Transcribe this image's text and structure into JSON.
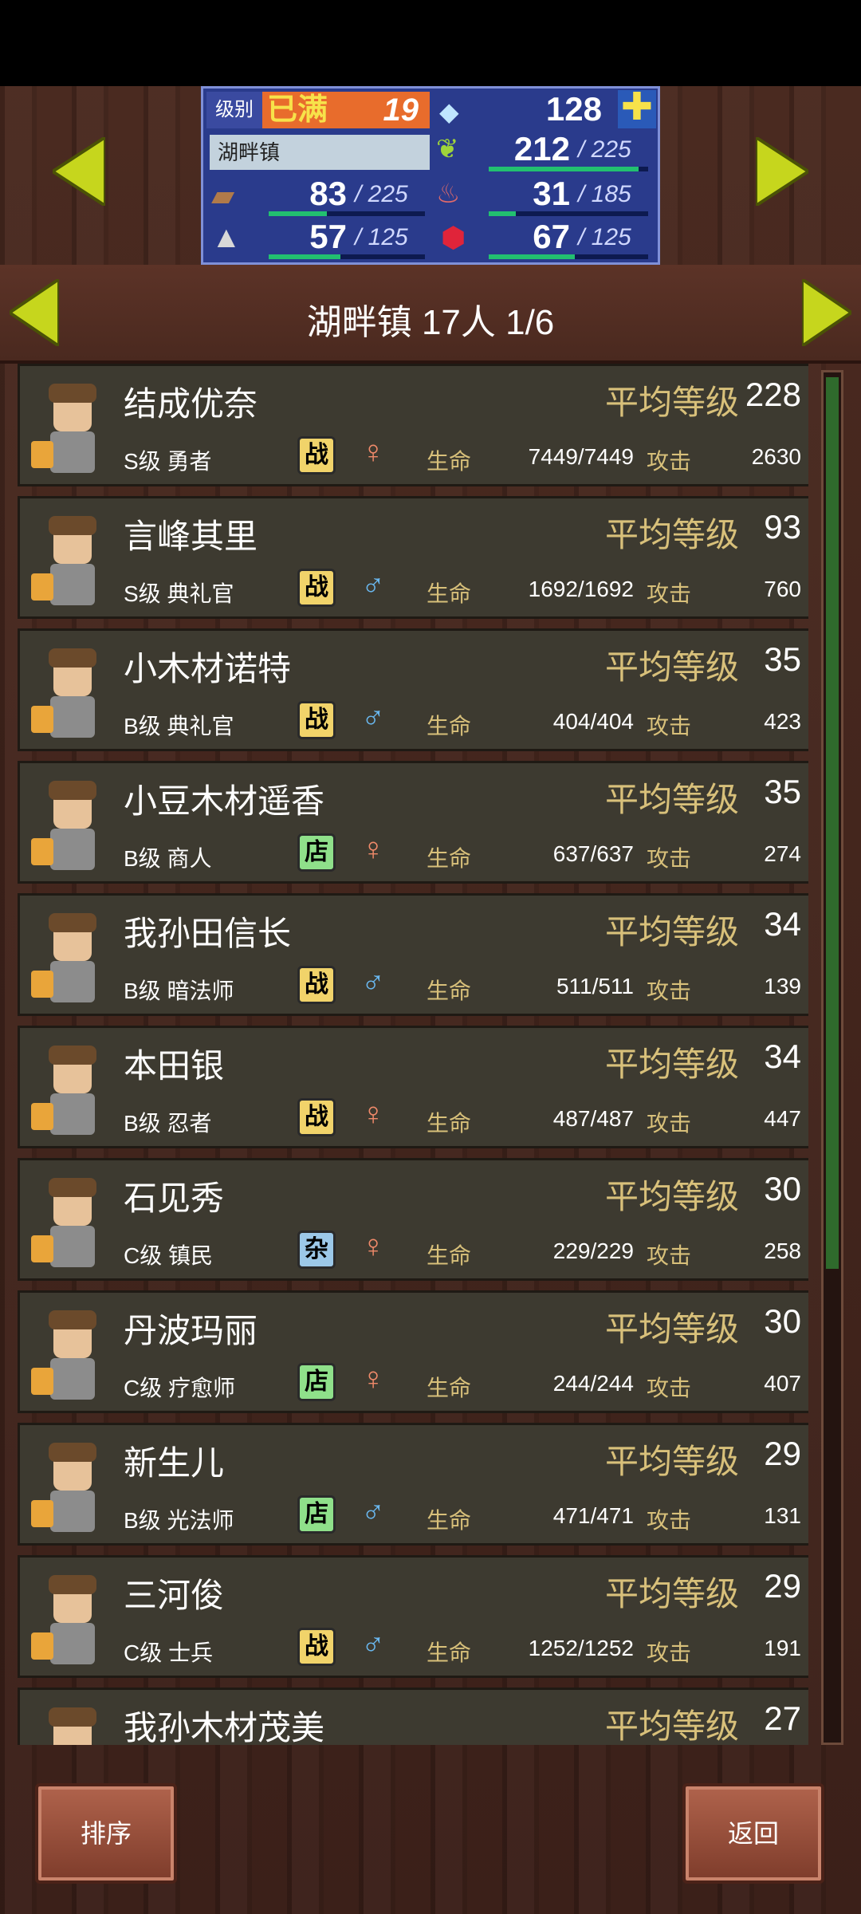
{
  "header": {
    "level_label": "级别",
    "level_status": "已满",
    "level_value": "19",
    "gems": "128",
    "town_name": "湖畔镇",
    "food": {
      "value": "212",
      "max": "225",
      "fill": 0.94
    },
    "wood": {
      "value": "83",
      "max": "225",
      "fill": 0.37
    },
    "meat": {
      "value": "31",
      "max": "185",
      "fill": 0.17
    },
    "ore": {
      "value": "57",
      "max": "125",
      "fill": 0.46
    },
    "ruby": {
      "value": "67",
      "max": "125",
      "fill": 0.54
    }
  },
  "town_bar": {
    "title": "湖畔镇  17人 1/6"
  },
  "labels": {
    "avg_level": "平均等级",
    "hp": "生命",
    "atk": "攻击"
  },
  "residents": [
    {
      "name": "结成优奈",
      "avg": "228",
      "class": "S级 勇者",
      "type": "战",
      "gender": "♀",
      "hp": "7449/7449",
      "atk": "2630"
    },
    {
      "name": "言峰其里",
      "avg": "93",
      "class": "S级 典礼官",
      "type": "战",
      "gender": "♂",
      "hp": "1692/1692",
      "atk": "760"
    },
    {
      "name": "小木材诺特",
      "avg": "35",
      "class": "B级 典礼官",
      "type": "战",
      "gender": "♂",
      "hp": "404/404",
      "atk": "423"
    },
    {
      "name": "小豆木材遥香",
      "avg": "35",
      "class": "B级 商人",
      "type": "店",
      "gender": "♀",
      "hp": "637/637",
      "atk": "274"
    },
    {
      "name": "我孙田信长",
      "avg": "34",
      "class": "B级 暗法师",
      "type": "战",
      "gender": "♂",
      "hp": "511/511",
      "atk": "139"
    },
    {
      "name": "本田银",
      "avg": "34",
      "class": "B级 忍者",
      "type": "战",
      "gender": "♀",
      "hp": "487/487",
      "atk": "447"
    },
    {
      "name": "石见秀",
      "avg": "30",
      "class": "C级 镇民",
      "type": "杂",
      "gender": "♀",
      "hp": "229/229",
      "atk": "258"
    },
    {
      "name": "丹波玛丽",
      "avg": "30",
      "class": "C级 疗愈师",
      "type": "店",
      "gender": "♀",
      "hp": "244/244",
      "atk": "407"
    },
    {
      "name": "新生儿",
      "avg": "29",
      "class": "B级 光法师",
      "type": "店",
      "gender": "♂",
      "hp": "471/471",
      "atk": "131"
    },
    {
      "name": "三河俊",
      "avg": "29",
      "class": "C级 士兵",
      "type": "战",
      "gender": "♂",
      "hp": "1252/1252",
      "atk": "191"
    },
    {
      "name": "我孙木材茂美",
      "avg": "27",
      "class": "",
      "type": "",
      "gender": "",
      "hp": "",
      "atk": ""
    }
  ],
  "badge_colors": {
    "战": "#f1d36a",
    "店": "#8fe08a",
    "杂": "#9cc8e8"
  },
  "gender_colors": {
    "♀": "#f08a6a",
    "♂": "#6ab8f0"
  },
  "buttons": {
    "sort": "排序",
    "back": "返回"
  }
}
